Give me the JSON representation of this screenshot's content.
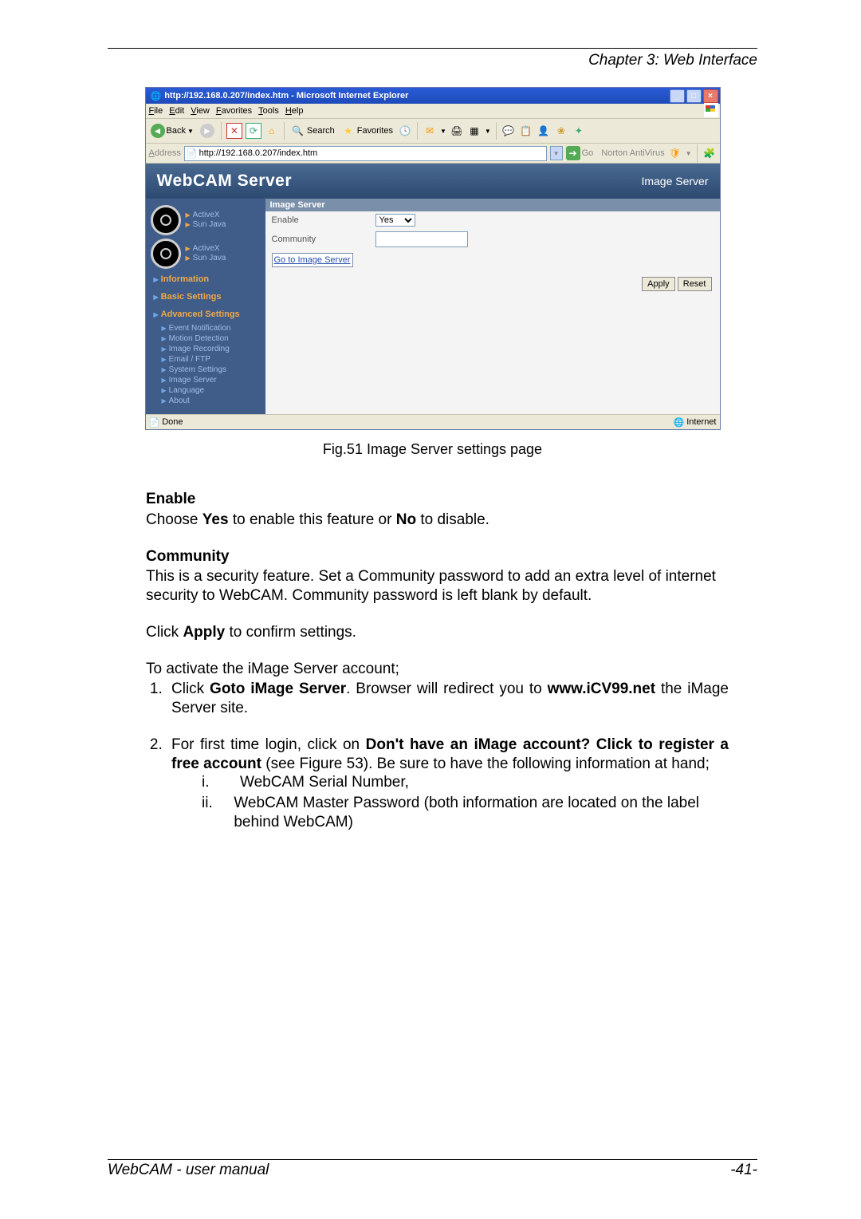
{
  "header": {
    "chapter": "Chapter 3: Web Interface"
  },
  "screenshot": {
    "title": "http://192.168.0.207/index.htm - Microsoft Internet Explorer",
    "menubar": [
      "File",
      "Edit",
      "View",
      "Favorites",
      "Tools",
      "Help"
    ],
    "toolbar": {
      "back": "Back",
      "search": "Search",
      "favorites": "Favorites"
    },
    "address": {
      "label": "Address",
      "url": "http://192.168.0.207/index.htm",
      "go": "Go",
      "antivirus": "Norton AntiVirus"
    },
    "app": {
      "title": "WebCAM Server",
      "right_label": "Image Server",
      "sidebar": {
        "cam1": {
          "a": "ActiveX",
          "b": "Sun Java"
        },
        "cam2": {
          "a": "ActiveX",
          "b": "Sun Java"
        },
        "info": "Information",
        "basic": "Basic Settings",
        "adv": "Advanced Settings",
        "subs": [
          "Event Notification",
          "Motion Detection",
          "Image Recording",
          "Email / FTP",
          "System Settings",
          "Image Server",
          "Language",
          "About"
        ]
      },
      "panel": {
        "head": "Image Server",
        "enable_label": "Enable",
        "enable_value": "Yes",
        "community_label": "Community",
        "go_link": "Go to Image Server",
        "apply": "Apply",
        "reset": "Reset"
      }
    },
    "status": {
      "done": "Done",
      "zone": "Internet"
    }
  },
  "figure_caption": "Fig.51  Image Server settings page",
  "body": {
    "enable_head": "Enable",
    "enable_text_pre": "Choose ",
    "enable_text_yes": "Yes",
    "enable_text_mid": " to enable this feature or ",
    "enable_text_no": "No",
    "enable_text_post": " to disable.",
    "community_head": "Community",
    "community_text": "This is a security feature.   Set a Community password to add an extra level of internet security to WebCAM.   Community password is left blank by default.",
    "apply_pre": "Click ",
    "apply_bold": "Apply",
    "apply_post": " to confirm settings.",
    "activate_text": "To activate the iMage Server account;",
    "step1_pre": "Click ",
    "step1_bold": "Goto iMage Server",
    "step1_mid": ".   Browser will redirect you to ",
    "step1_bold2": "www.iCV99.net",
    "step1_post": " the iMage Server site.",
    "step2_pre": "For first time login, click on ",
    "step2_bold": "Don't have an iMage account? Click to register a free account",
    "step2_post": " (see Figure 53).  Be sure to have the following information at hand;",
    "roman_i_num": "i.",
    "roman_i_text": "WebCAM Serial Number,",
    "roman_ii_num": "ii.",
    "roman_ii_text": "WebCAM Master Password (both information are located on the label behind WebCAM)"
  },
  "footer": {
    "left": "WebCAM - user manual",
    "right": "-41-"
  }
}
